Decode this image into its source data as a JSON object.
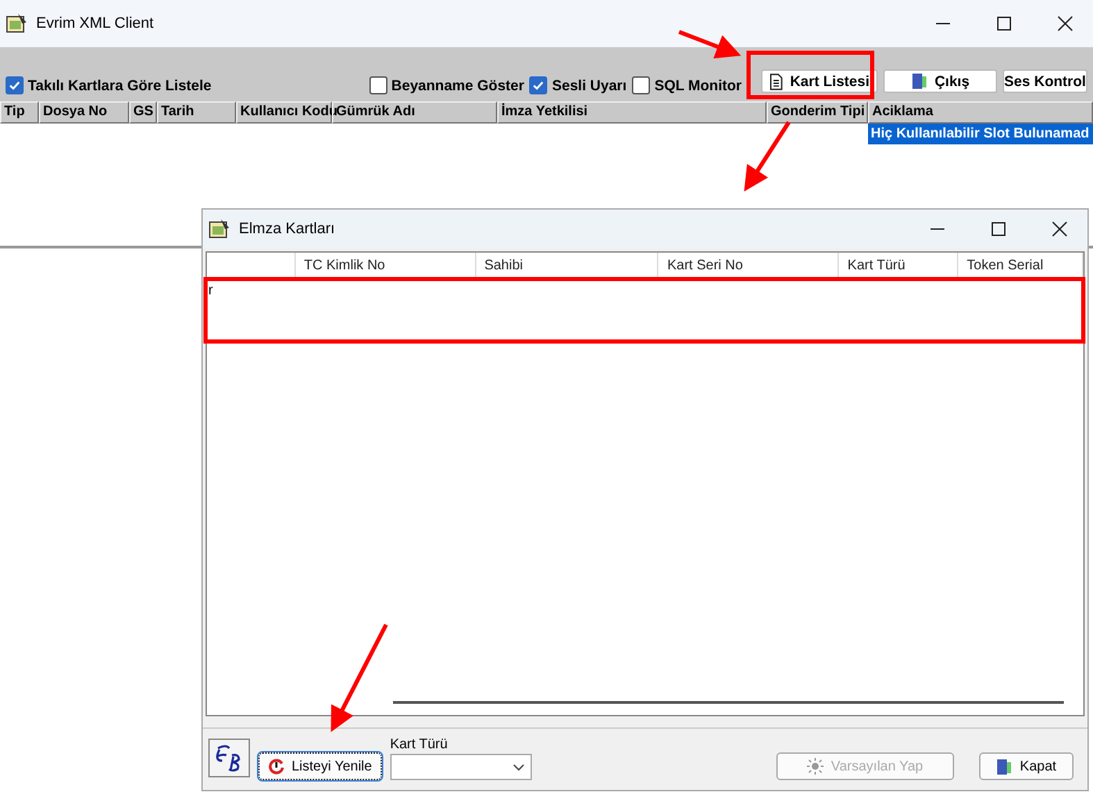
{
  "main_window": {
    "title": "Evrim XML Client",
    "options": [
      {
        "label": "Takılı Kartlara Göre Listele",
        "checked": true
      }
    ],
    "toggles": [
      {
        "label": "Beyanname Göster",
        "checked": false
      },
      {
        "label": "Sesli Uyarı",
        "checked": true
      },
      {
        "label": "SQL Monitor",
        "checked": false
      }
    ],
    "buttons": [
      {
        "label": "Kart Listesi",
        "kind": "document"
      },
      {
        "label": "Çıkış",
        "kind": "exit"
      },
      {
        "label": "Ses Kontrol",
        "kind": "plain"
      }
    ],
    "table": {
      "columns": [
        "Tip",
        "Dosya No",
        "GS",
        "Tarih",
        "Kullanıcı Kodu",
        "Gümrük Adı",
        "İmza Yetkilisi",
        "Gonderim Tipi",
        "Aciklama"
      ],
      "rows": [
        {
          "aciklama": "Hiç Kullanılabilir Slot Bulunamad",
          "selected": true
        }
      ]
    }
  },
  "dialog": {
    "title": "Elmza Kartları",
    "table": {
      "columns": [
        "",
        "TC Kimlik No",
        "Sahibi",
        "Kart Seri No",
        "Kart Türü",
        "Token Serial"
      ],
      "rows": [
        {
          "cell": "r"
        }
      ]
    },
    "refresh_button": "Listeyi Yenile",
    "card_type": {
      "label": "Kart Türü"
    },
    "default_button": {
      "label": "Varsayılan Yap",
      "disabled": true
    },
    "close_button": "Kapat"
  }
}
